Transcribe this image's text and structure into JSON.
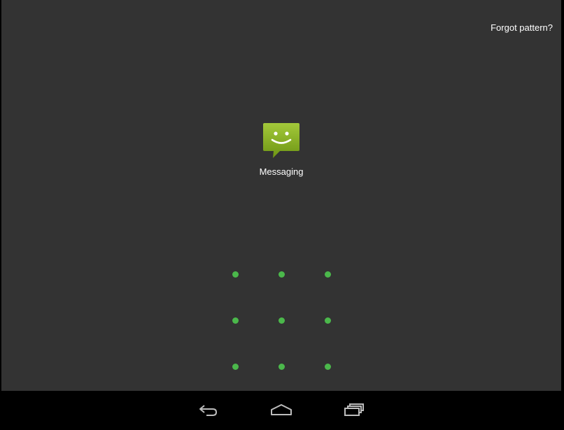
{
  "lock_screen": {
    "forgot_label": "Forgot pattern?",
    "app": {
      "name": "Messaging",
      "icon": "messaging-smiley-icon",
      "icon_color": "#8bb51f"
    },
    "pattern_color": "#4bb84b"
  },
  "navbar": {
    "buttons": [
      "back-icon",
      "home-icon",
      "recent-apps-icon"
    ]
  }
}
